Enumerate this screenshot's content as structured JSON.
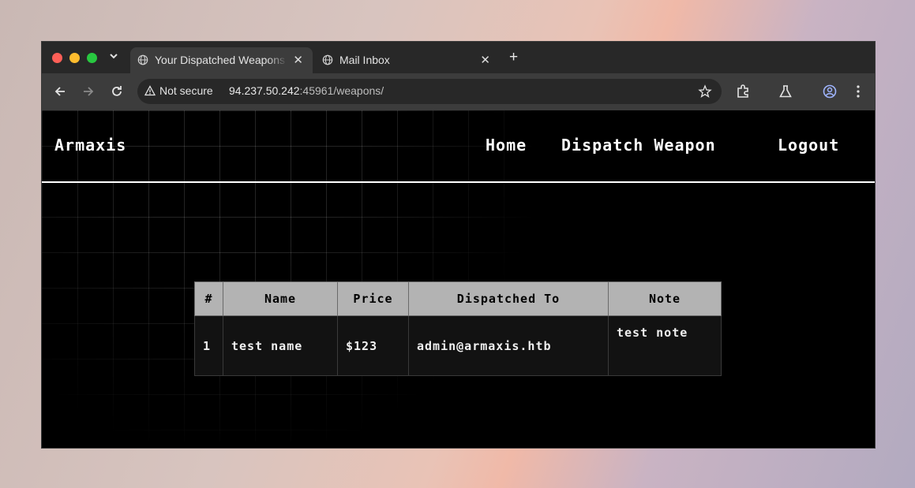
{
  "browser": {
    "tabs": [
      {
        "title": "Your Dispatched Weapons",
        "active": true
      },
      {
        "title": "Mail Inbox",
        "active": false
      }
    ],
    "security_label": "Not secure",
    "url_host": "94.237.50.242",
    "url_rest": ":45961/weapons/"
  },
  "site": {
    "brand": "Armaxis",
    "nav": {
      "home": "Home",
      "dispatch": "Dispatch Weapon",
      "logout": "Logout"
    }
  },
  "table": {
    "headers": [
      "#",
      "Name",
      "Price",
      "Dispatched To",
      "Note"
    ],
    "rows": [
      [
        "1",
        "test name",
        "$123",
        "admin@armaxis.htb",
        "test note"
      ]
    ]
  }
}
